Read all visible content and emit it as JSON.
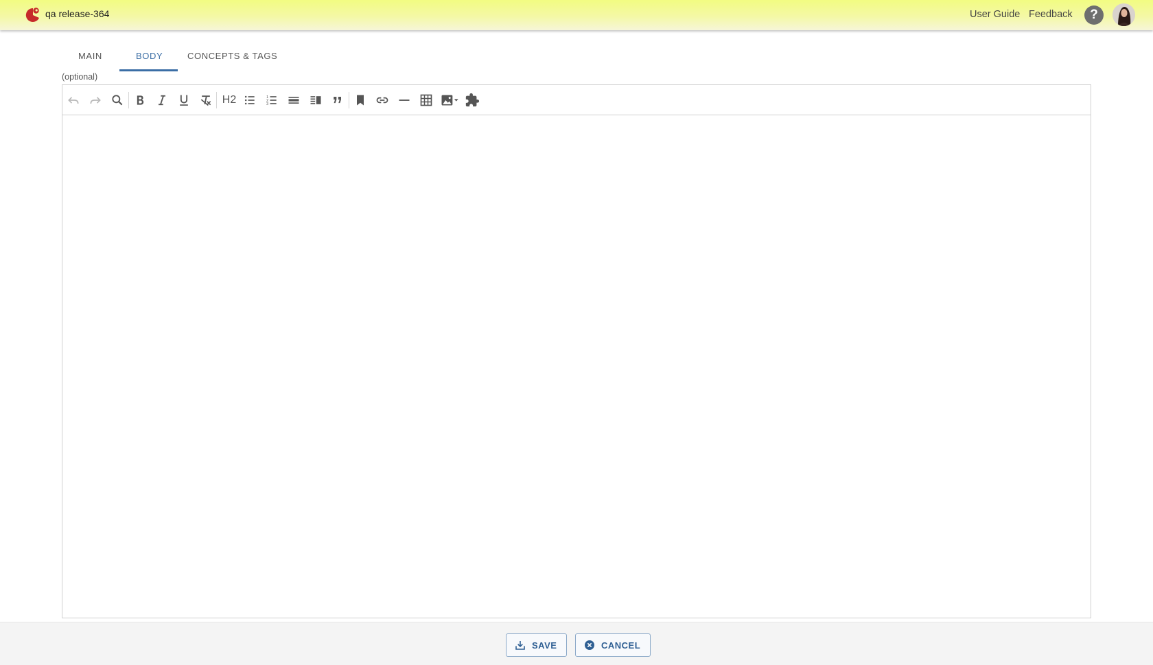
{
  "header": {
    "app_title": "qa release-364",
    "links": [
      "User Guide",
      "Feedback"
    ],
    "help_symbol": "?",
    "accent_color": "#f2fc82"
  },
  "tabs": [
    {
      "label": "MAIN",
      "active": false
    },
    {
      "label": "BODY",
      "active": true
    },
    {
      "label": "CONCEPTS & TAGS",
      "active": false
    }
  ],
  "editor": {
    "field_hint": "(optional)",
    "content": "",
    "toolbar": [
      {
        "name": "undo-icon",
        "disabled": true
      },
      {
        "name": "redo-icon",
        "disabled": true
      },
      {
        "name": "search-icon"
      },
      {
        "name": "bold-icon"
      },
      {
        "name": "italic-icon"
      },
      {
        "name": "underline-icon"
      },
      {
        "name": "clear-formatting-icon"
      },
      {
        "name": "heading-h2",
        "label": "H2"
      },
      {
        "name": "bulleted-list-icon"
      },
      {
        "name": "numbered-list-icon"
      },
      {
        "name": "block-icon"
      },
      {
        "name": "side-content-icon"
      },
      {
        "name": "blockquote-icon"
      },
      {
        "name": "bookmark-icon"
      },
      {
        "name": "link-icon"
      },
      {
        "name": "horizontal-rule-icon"
      },
      {
        "name": "table-icon"
      },
      {
        "name": "image-dropdown-icon"
      },
      {
        "name": "plugin-icon"
      }
    ]
  },
  "footer": {
    "save_label": "SAVE",
    "cancel_label": "CANCEL",
    "button_color": "#2f5f93"
  }
}
